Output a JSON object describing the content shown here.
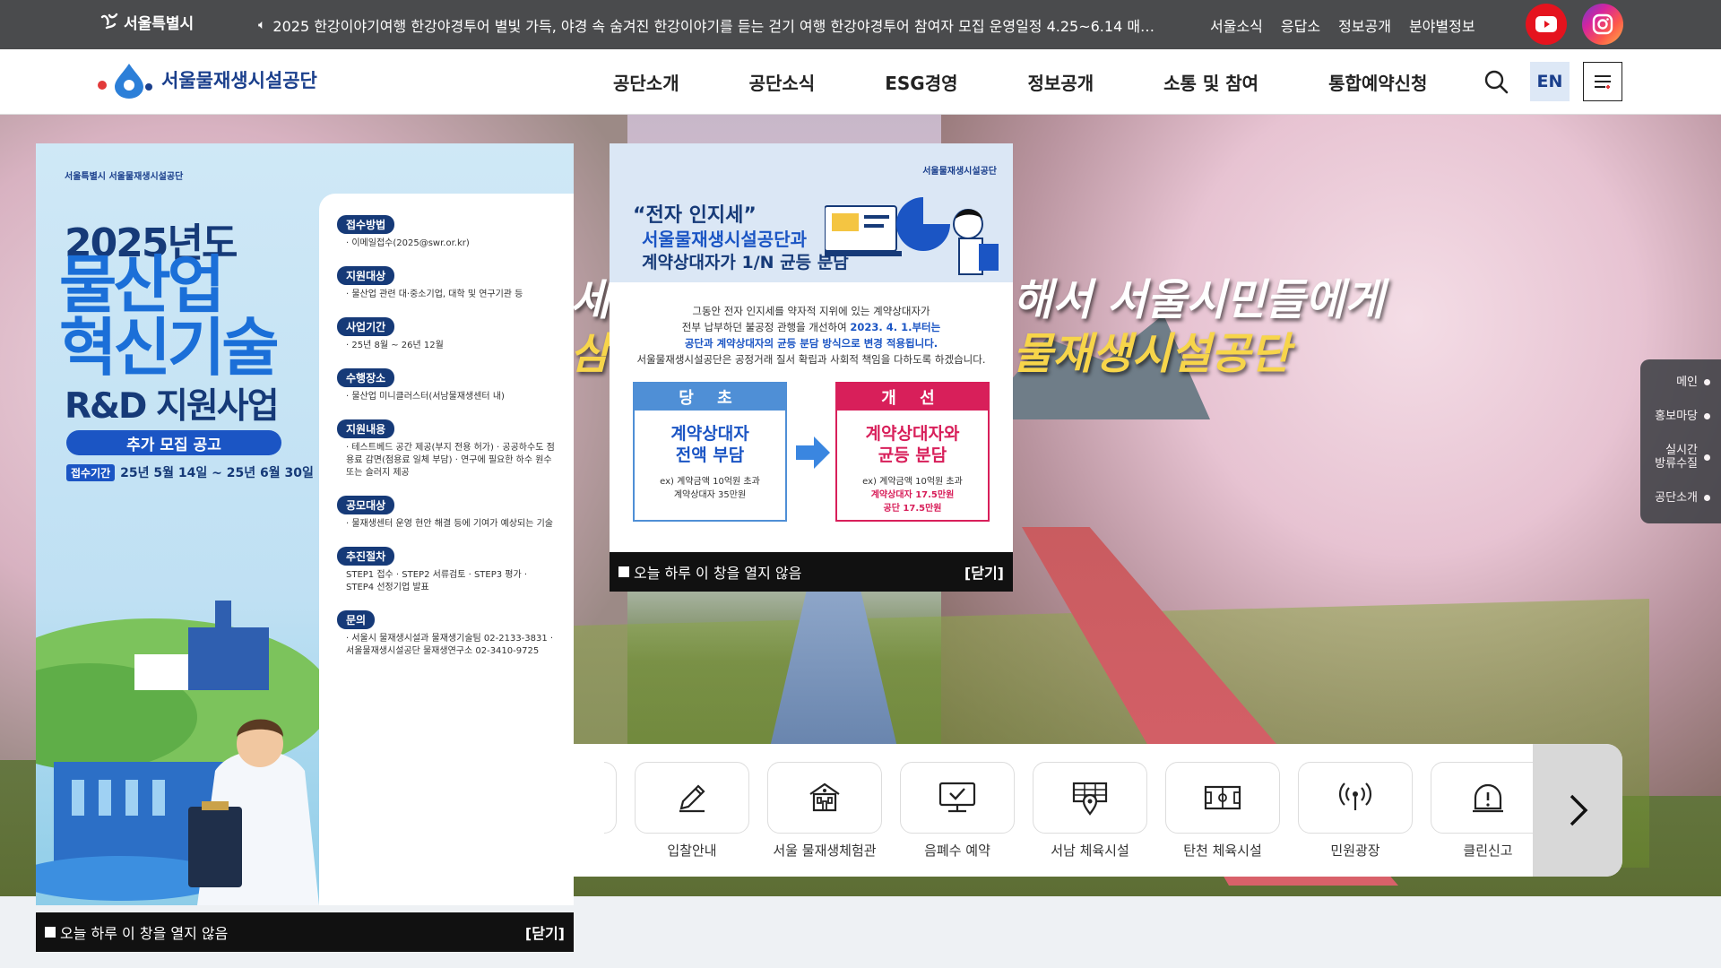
{
  "topbar": {
    "seoul_logo": "서울특별시",
    "ticker": "2025 한강이야기여행 한강야경투어 별빛 가득, 야경 속 숨겨진 한강이야기를 듣는 걷기 여행 한강야경투어 참여자 모집 운영일정 4.25~6.14 매…",
    "links": [
      "서울소식",
      "응답소",
      "정보공개",
      "분야별정보"
    ],
    "youtube_color": "#e5131e"
  },
  "nav": {
    "org_name": "서울물재생시설공단",
    "menu": [
      "공단소개",
      "공단소식",
      "ESG경영",
      "정보공개",
      "소통 및 참여",
      "통합예약신청"
    ],
    "lang": "EN"
  },
  "hero": {
    "line1_left": "세깃",
    "line2_left": "삼의",
    "line1": "해서 서울시민들에게",
    "line2": "물재생시설공단"
  },
  "sidenav": [
    "메인",
    "홍보마당",
    "실시간\n방류수질",
    "공단소개"
  ],
  "quicknav": {
    "items": [
      {
        "label": "입찰안내",
        "icon": "pencil-icon"
      },
      {
        "label": "서울 물재생체험관",
        "icon": "building-icon"
      },
      {
        "label": "음폐수 예약",
        "icon": "monitor-check-icon"
      },
      {
        "label": "서남 체육시설",
        "icon": "court-location-icon"
      },
      {
        "label": "탄천 체육시설",
        "icon": "field-icon"
      },
      {
        "label": "민원광장",
        "icon": "broadcast-icon"
      },
      {
        "label": "클린신고",
        "icon": "alert-bell-icon"
      }
    ]
  },
  "popup1": {
    "logos": "서울특별시  서울물재생시설공단",
    "year": "2025년도",
    "title1": "물산업",
    "title2": "혁신기술",
    "subtitle": "R&D 지원사업",
    "badge": "추가 모집 공고",
    "period_tag": "접수기간",
    "period": "25년 5월 14일 ~ 25년 6월 30일",
    "sections": [
      {
        "h": "접수방법",
        "t": "· 이메일접수(2025@swr.or.kr)"
      },
      {
        "h": "지원대상",
        "t": "· 물산업 관련 대·중소기업, 대학 및 연구기관 등"
      },
      {
        "h": "사업기간",
        "t": "· 25년 8월 ~ 26년 12월"
      },
      {
        "h": "수행장소",
        "t": "· 물산업 미니클러스터(서남물재생센터 내)"
      },
      {
        "h": "지원내용",
        "t": "· 테스트베드 공간 제공(부지 전용 허가) · 공공하수도 점용료 감면(점용료 일체 부담) · 연구에 필요한 하수 원수 또는 슬러지 제공"
      },
      {
        "h": "공모대상",
        "t": "· 물재생센터 운영 현안 해결 등에 기여가 예상되는 기술"
      },
      {
        "h": "추진절차",
        "t": "STEP1 접수 · STEP2 서류검토 · STEP3 평가 · STEP4 선정기업 발표"
      },
      {
        "h": "문의",
        "t": "· 서울시 물재생시설과 물재생기술팀 02-2133-3831 · 서울물재생시설공단 물재생연구소 02-3410-9725"
      }
    ],
    "dont_show": "오늘 하루 이 창을 열지 않음",
    "close": "[닫기]"
  },
  "popup2": {
    "logo": "서울물재생시설공단",
    "title1": "“전자 인지세”",
    "title2": "서울물재생시설공단과",
    "title3": "계약상대자가 1/N 균등 분담",
    "desc1": "그동안 전자 인지세를 약자적 지위에 있는 계약상대자가",
    "desc2": "전부 납부하던 불공정 관행을 개선하여",
    "desc2b": "2023. 4. 1.부터는",
    "desc3": "공단과 계약상대자의 균등 분담 방식으로 변경 적용됩니다.",
    "desc4": "서울물재생시설공단은 공정거래 질서 확립과 사회적 책임을 다하도록 하겠습니다.",
    "before_head": "당 초",
    "before_main1": "계약상대자",
    "before_main2": "전액 부담",
    "before_sub1": "ex) 계약금액 10억원 초과",
    "before_sub2": "계약상대자 35만원",
    "after_head": "개 선",
    "after_main1": "계약상대자와",
    "after_main2": "균등 분담",
    "after_sub1": "ex) 계약금액 10억원 초과",
    "after_sub2": "계약상대자 17.5만원",
    "after_sub3": "공단 17.5만원",
    "dont_show": "오늘 하루 이 창을 열지 않음",
    "close": "[닫기]"
  }
}
